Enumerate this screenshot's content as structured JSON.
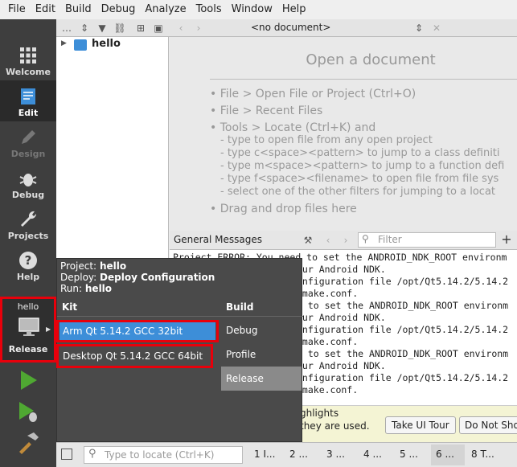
{
  "menubar": [
    "File",
    "Edit",
    "Build",
    "Debug",
    "Analyze",
    "Tools",
    "Window",
    "Help"
  ],
  "modes": [
    {
      "label": "Welcome",
      "icon": "grid-icon"
    },
    {
      "label": "Edit",
      "icon": "edit-document-icon"
    },
    {
      "label": "Design",
      "icon": "pencil-icon"
    },
    {
      "label": "Debug",
      "icon": "bug-icon"
    },
    {
      "label": "Projects",
      "icon": "wrench-icon"
    },
    {
      "label": "Help",
      "icon": "help-icon"
    }
  ],
  "kit_selector": {
    "project": "hello",
    "config": "Release"
  },
  "project_tree": {
    "root": "hello"
  },
  "document_selector": "<no document>",
  "editor": {
    "title": "Open a document",
    "lines": [
      "• File > Open File or Project (Ctrl+O)",
      "• File > Recent Files",
      "• Tools > Locate (Ctrl+K) and"
    ],
    "sublines": [
      "- type to open file from any open project",
      "- type c<space><pattern> to jump to a class definiti",
      "- type m<space><pattern> to jump to a function defi",
      "- type f<space><filename> to open file from file sys",
      "- select one of the other filters for jumping to a locat"
    ],
    "drag": "• Drag and drop files here"
  },
  "general_messages": {
    "title": "General Messages",
    "filter_placeholder": "Filter",
    "lines": [
      "Project ERROR: You need to set the ANDROID_NDK_ROOT environm",
      "our Android NDK.",
      "onfiguration file /opt/Qt5.14.2/5.14.2",
      "qmake.conf.",
      "d to set the ANDROID_NDK_ROOT environm",
      "our Android NDK.",
      "onfiguration file /opt/Qt5.14.2/5.14.2",
      "qmake.conf.",
      "d to set the ANDROID_NDK_ROOT environm",
      "our Android NDK.",
      "onfiguration file /opt/Qt5.14.2/5.14.2",
      "qmake.conf."
    ]
  },
  "tour": {
    "line1": "ghlights",
    "line2": "they are used.",
    "take_tour": "Take UI Tour",
    "do_not_show": "Do Not Sho"
  },
  "popup": {
    "project_label": "Project:",
    "project": "hello",
    "deploy_label": "Deploy:",
    "deploy": "Deploy Configuration",
    "run_label": "Run:",
    "run": "hello",
    "kit_header": "Kit",
    "build_header": "Build",
    "kits": [
      "Arm Qt 5.14.2 GCC 32bit",
      "Desktop Qt 5.14.2 GCC 64bit"
    ],
    "builds": [
      "Debug",
      "Profile",
      "Release"
    ]
  },
  "status": {
    "locate_placeholder": "Type to locate (Ctrl+K)",
    "tabs": [
      "1 I...",
      "2 ...",
      "3 ...",
      "4 ...",
      "5 ...",
      "6 ...",
      "8 T..."
    ]
  },
  "colors": {
    "accent": "#3d8ed8",
    "highlight_red": "#e8000b",
    "run_green": "#4fa832"
  }
}
